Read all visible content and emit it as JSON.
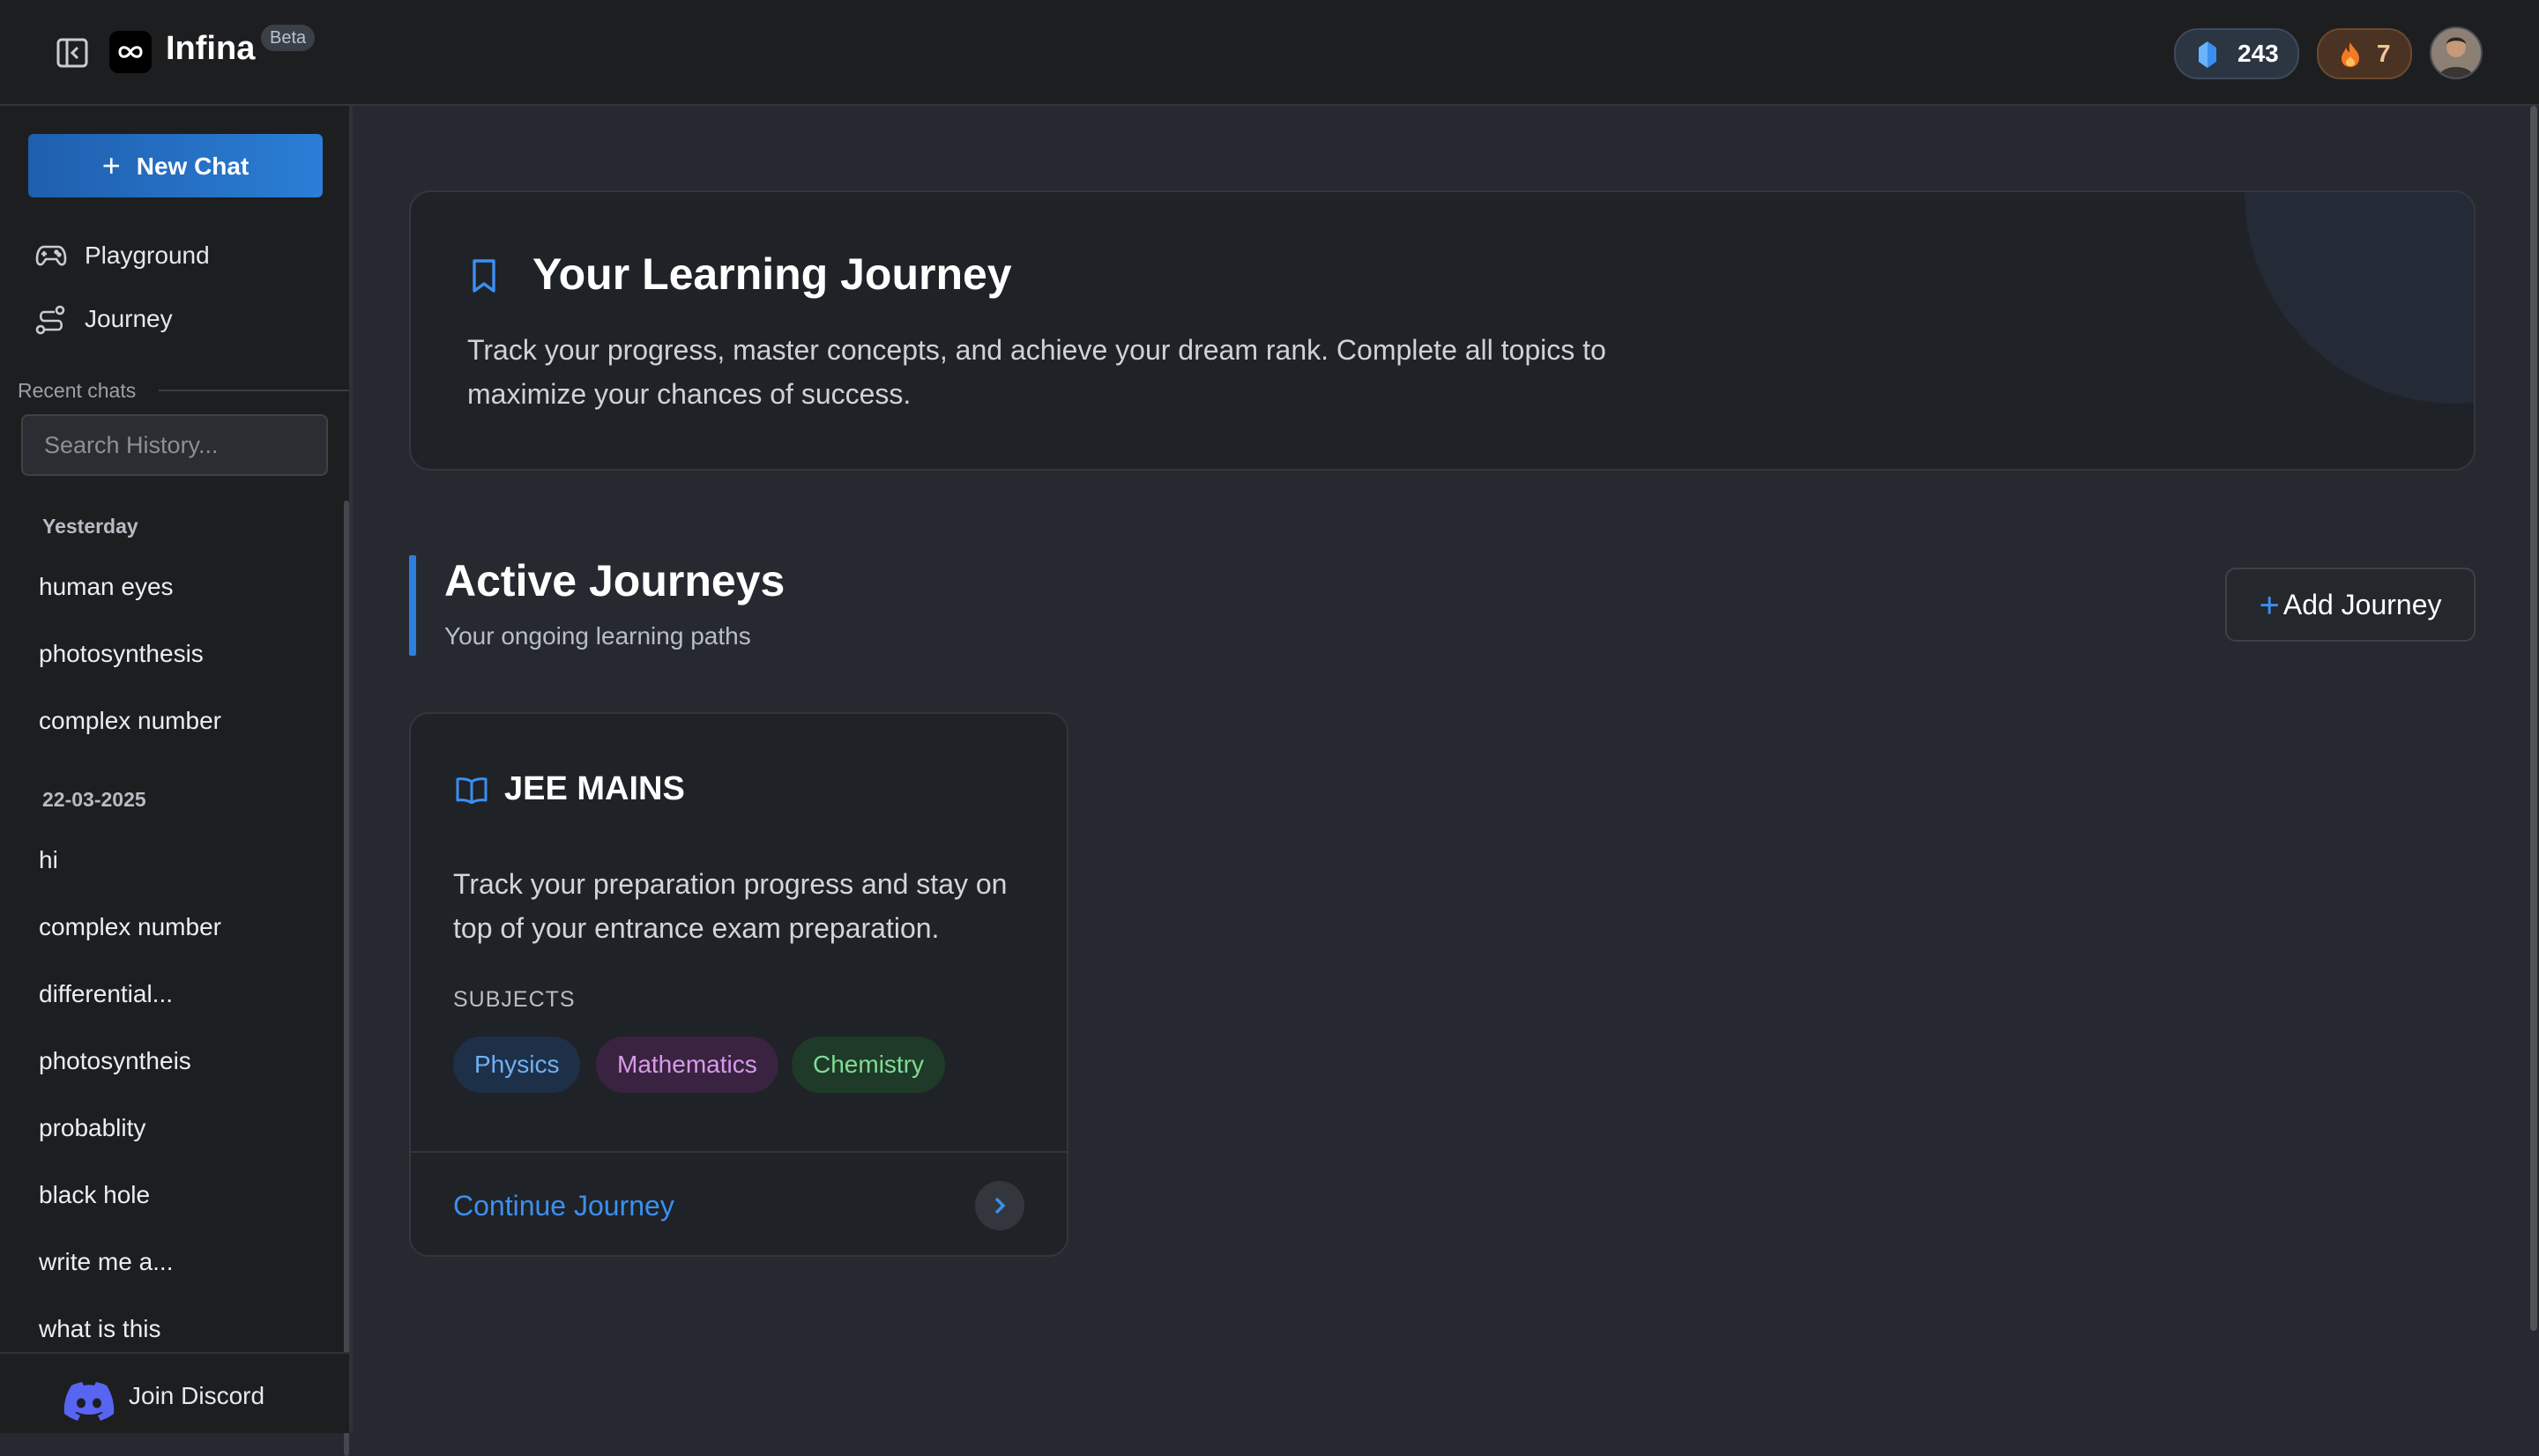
{
  "header": {
    "app_name": "Infina",
    "beta_label": "Beta",
    "gems_count": "243",
    "streak_count": "7"
  },
  "sidebar": {
    "new_chat_label": "New Chat",
    "nav": [
      {
        "label": "Playground",
        "icon": "gamepad-icon"
      },
      {
        "label": "Journey",
        "icon": "route-icon"
      }
    ],
    "recent_label": "Recent chats",
    "search_placeholder": "Search History...",
    "groups": [
      {
        "label": "Yesterday",
        "items": [
          "human eyes",
          "photosynthesis",
          "complex number"
        ]
      },
      {
        "label": "22-03-2025",
        "items": [
          "hi",
          "complex number",
          "differential...",
          "photosyntheis",
          "probablity",
          "black hole",
          "write me a...",
          "what is this"
        ]
      }
    ],
    "discord_label": "Join Discord"
  },
  "hero": {
    "title": "Your Learning Journey",
    "description": "Track your progress, master concepts, and achieve your dream rank. Complete all topics to maximize your chances of success."
  },
  "active": {
    "title": "Active Journeys",
    "subtitle": "Your ongoing learning paths",
    "add_label": "Add Journey"
  },
  "journey_card": {
    "title": "JEE MAINS",
    "description": "Track your preparation progress and stay on top of your entrance exam preparation.",
    "subjects_label": "SUBJECTS",
    "subjects": [
      "Physics",
      "Mathematics",
      "Chemistry"
    ],
    "continue_label": "Continue Journey"
  },
  "colors": {
    "accent": "#2d7fe0",
    "background": "#262a30",
    "sidebar": "#1d1e20"
  }
}
